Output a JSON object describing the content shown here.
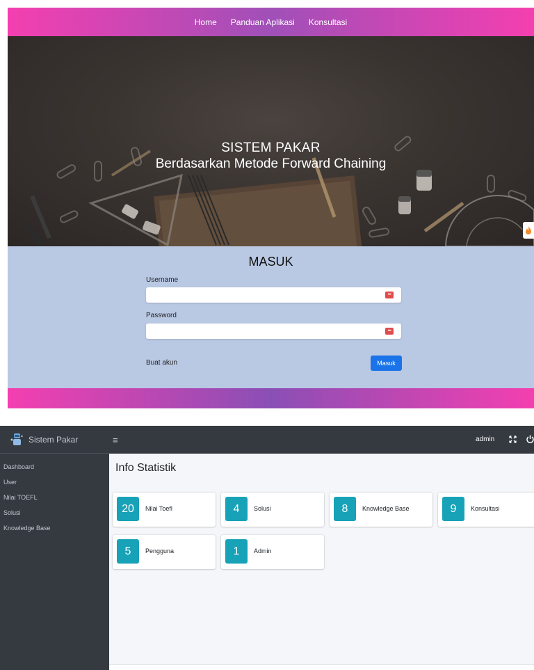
{
  "login_page": {
    "nav": {
      "items": [
        "Home",
        "Panduan Aplikasi",
        "Konsultasi"
      ]
    },
    "hero": {
      "title": "SISTEM PAKAR",
      "subtitle": "Berdasarkan Metode Forward Chaining"
    },
    "form": {
      "heading": "MASUK",
      "username_label": "Username",
      "username_value": "",
      "password_label": "Password",
      "password_value": "",
      "create_account_link": "Buat akun",
      "submit_label": "Masuk"
    },
    "colors": {
      "nav_gradient_start": "#f43fb0",
      "nav_gradient_mid": "#a050b8",
      "panel_bg": "#b9c8e3",
      "submit_bg": "#1a73e8",
      "password_manager_icon": "#e04c4c"
    }
  },
  "admin_page": {
    "brand": "Sistem Pakar",
    "topbar": {
      "user": "admin"
    },
    "sidebar": {
      "items": [
        "Dashboard",
        "User",
        "Nilai TOEFL",
        "Solusi",
        "Knowledge Base"
      ]
    },
    "content": {
      "title": "Info Statistik",
      "stats": [
        {
          "count": "20",
          "label": "Nilai Toefl"
        },
        {
          "count": "4",
          "label": "Solusi"
        },
        {
          "count": "8",
          "label": "Knowledge Base"
        },
        {
          "count": "9",
          "label": "Konsultasi"
        },
        {
          "count": "5",
          "label": "Pengguna"
        },
        {
          "count": "1",
          "label": "Admin"
        }
      ]
    },
    "icons": {
      "brand": "brand-logo-icon",
      "menu": "hamburger-icon",
      "fullscreen": "expand-arrows-icon",
      "logout": "power-icon"
    },
    "colors": {
      "sidebar_bg": "#343a40",
      "stat_icon_bg": "#17a2b8",
      "content_bg": "#f4f6f9"
    }
  }
}
